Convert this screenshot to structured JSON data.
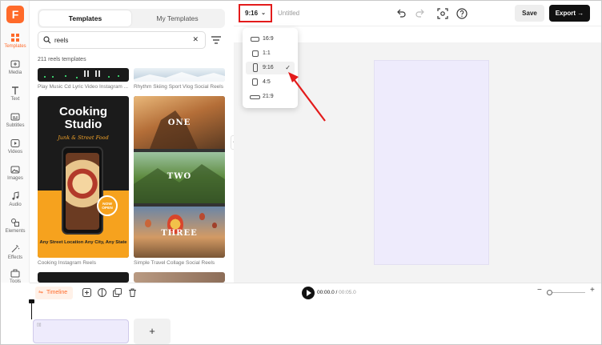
{
  "app": {
    "logo": "F",
    "brand_color": "#ff6a2a"
  },
  "rail": [
    {
      "label": "Templates",
      "icon": "templates-icon"
    },
    {
      "label": "Media",
      "icon": "media-icon"
    },
    {
      "label": "Text",
      "icon": "text-icon"
    },
    {
      "label": "Subtitles",
      "icon": "subtitles-icon"
    },
    {
      "label": "Videos",
      "icon": "videos-icon"
    },
    {
      "label": "Images",
      "icon": "images-icon"
    },
    {
      "label": "Audio",
      "icon": "audio-icon"
    },
    {
      "label": "Elements",
      "icon": "elements-icon"
    },
    {
      "label": "Effects",
      "icon": "effects-icon"
    },
    {
      "label": "Tools",
      "icon": "tools-icon"
    }
  ],
  "panel": {
    "tabs": [
      "Templates",
      "My Templates"
    ],
    "search_value": "reels",
    "count_text": "211 reels templates",
    "templates": [
      {
        "caption": "Play Music Cd Lyric Video Instagram ..."
      },
      {
        "caption": "Rhythm Skiing Sport Vlog Social Reels"
      },
      {
        "caption": "Cooking Instagram Reels",
        "title": "Cooking Studio",
        "subtitle": "Junk & Street Food",
        "badge": "NOW OPEN",
        "address": "Any Street Location Any City, Any State"
      },
      {
        "caption": "Simple Travel Collage Social Reels",
        "words": [
          "ONE",
          "TWO",
          "THREE"
        ]
      }
    ]
  },
  "topbar": {
    "ratio": "9:16",
    "doc_title": "Untitled",
    "save": "Save",
    "export": "Export"
  },
  "ratio_options": [
    {
      "label": "16:9",
      "selected": false
    },
    {
      "label": "1:1",
      "selected": false
    },
    {
      "label": "9:16",
      "selected": true
    },
    {
      "label": "4:5",
      "selected": false
    },
    {
      "label": "21:9",
      "selected": false
    }
  ],
  "timeline": {
    "label": "Timeline",
    "current": "00:00.0",
    "total": "00:05.0",
    "add": "+"
  },
  "colors": {
    "annotation": "#e31b1b",
    "artboard": "#eeebfc",
    "export_bg": "#111111"
  }
}
